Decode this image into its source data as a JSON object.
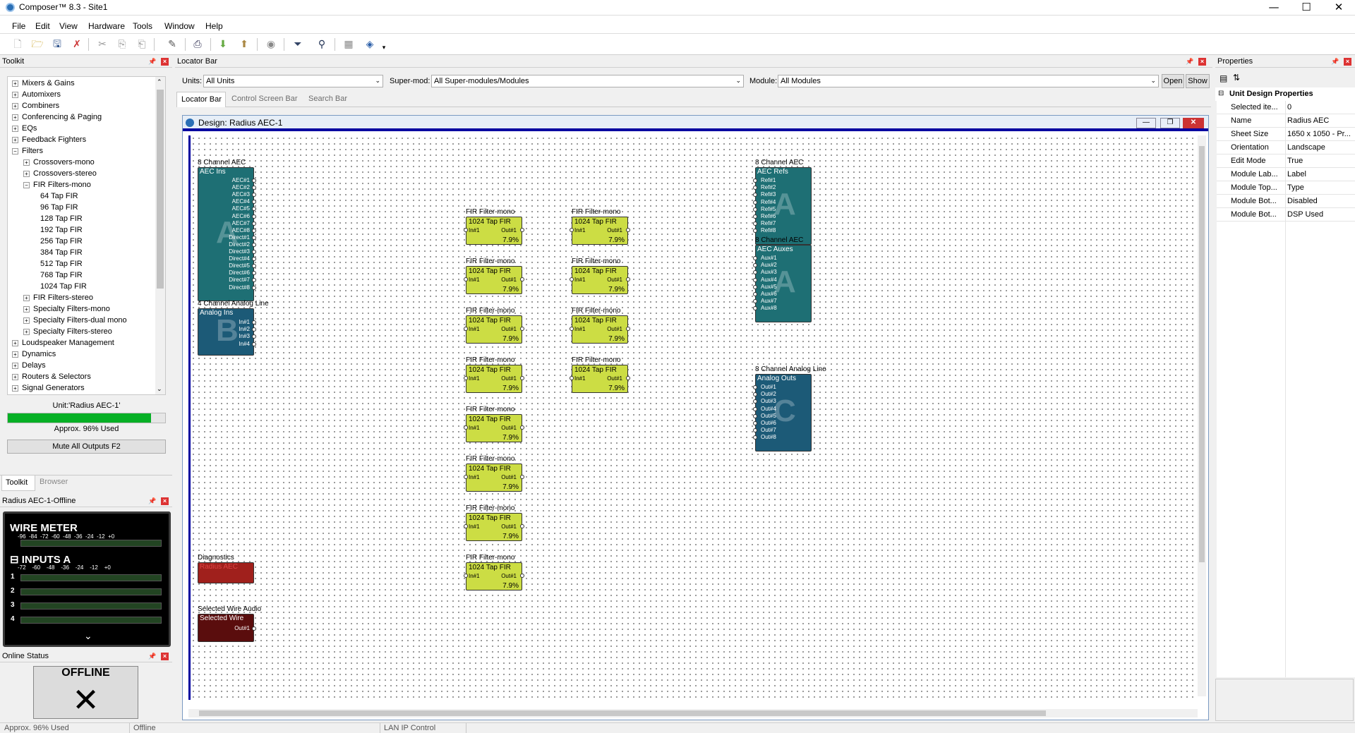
{
  "app": {
    "title": "Composer™ 8.3 - Site1"
  },
  "menu": [
    "File",
    "Edit",
    "View",
    "Hardware",
    "Tools",
    "Window",
    "Help"
  ],
  "toolkit": {
    "title": "Toolkit",
    "tree": [
      {
        "label": "Mixers & Gains",
        "expander": "+",
        "level": 0
      },
      {
        "label": "Automixers",
        "expander": "+",
        "level": 0
      },
      {
        "label": "Combiners",
        "expander": "+",
        "level": 0
      },
      {
        "label": "Conferencing & Paging",
        "expander": "+",
        "level": 0
      },
      {
        "label": "EQs",
        "expander": "+",
        "level": 0
      },
      {
        "label": "Feedback Fighters",
        "expander": "+",
        "level": 0
      },
      {
        "label": "Filters",
        "expander": "−",
        "level": 0
      },
      {
        "label": "Crossovers-mono",
        "expander": "+",
        "level": 1
      },
      {
        "label": "Crossovers-stereo",
        "expander": "+",
        "level": 1
      },
      {
        "label": "FIR Filters-mono",
        "expander": "−",
        "level": 1
      },
      {
        "label": "64 Tap FIR",
        "expander": "",
        "level": 2
      },
      {
        "label": "96 Tap FIR",
        "expander": "",
        "level": 2
      },
      {
        "label": "128 Tap FIR",
        "expander": "",
        "level": 2
      },
      {
        "label": "192 Tap FIR",
        "expander": "",
        "level": 2
      },
      {
        "label": "256 Tap FIR",
        "expander": "",
        "level": 2
      },
      {
        "label": "384 Tap FIR",
        "expander": "",
        "level": 2
      },
      {
        "label": "512 Tap FIR",
        "expander": "",
        "level": 2
      },
      {
        "label": "768 Tap FIR",
        "expander": "",
        "level": 2
      },
      {
        "label": "1024 Tap FIR",
        "expander": "",
        "level": 2
      },
      {
        "label": "FIR Filters-stereo",
        "expander": "+",
        "level": 1
      },
      {
        "label": "Specialty Filters-mono",
        "expander": "+",
        "level": 1
      },
      {
        "label": "Specialty Filters-dual mono",
        "expander": "+",
        "level": 1
      },
      {
        "label": "Specialty Filters-stereo",
        "expander": "+",
        "level": 1
      },
      {
        "label": "Loudspeaker Management",
        "expander": "+",
        "level": 0
      },
      {
        "label": "Dynamics",
        "expander": "+",
        "level": 0
      },
      {
        "label": "Delays",
        "expander": "+",
        "level": 0
      },
      {
        "label": "Routers & Selectors",
        "expander": "+",
        "level": 0
      },
      {
        "label": "Signal Generators",
        "expander": "+",
        "level": 0
      }
    ],
    "unit_label": "Unit:'Radius AEC-1'",
    "usage_label": "Approx. 96% Used",
    "usage_fraction": 0.96,
    "mute_button": "Mute All Outputs  F2",
    "tabs": [
      "Toolkit",
      "Browser"
    ]
  },
  "meter_panel": {
    "title": "Radius AEC-1-Offline",
    "wire_meter": "WIRE METER",
    "scale1": "-96  -84  -72  -60  -48  -36  -24  -12  +0",
    "inputs": "INPUTS A",
    "scale2": "-72    -60    -48    -36    -24    -12    +0",
    "rows": [
      "1",
      "2",
      "3",
      "4"
    ],
    "chevron": "⌄"
  },
  "online": {
    "title": "Online Status",
    "text": "OFFLINE"
  },
  "locator": {
    "title": "Locator Bar",
    "units_label": "Units:",
    "units_value": "All Units",
    "supermod_label": "Super-mod:",
    "supermod_value": "All Super-modules/Modules",
    "module_label": "Module:",
    "module_value": "All Modules",
    "open": "Open",
    "show": "Show",
    "tabs": [
      "Locator Bar",
      "Control Screen Bar",
      "Search Bar"
    ]
  },
  "design": {
    "title": "Design: Radius AEC-1",
    "aec_ins": {
      "caption": "8 Channel AEC",
      "title": "AEC Ins",
      "ports": [
        "AEC#1",
        "AEC#2",
        "AEC#3",
        "AEC#4",
        "AEC#5",
        "AEC#6",
        "AEC#7",
        "AEC#8",
        "Direct#1",
        "Direct#2",
        "Direct#3",
        "Direct#4",
        "Direct#5",
        "Direct#6",
        "Direct#7",
        "Direct#8"
      ],
      "letter": "A"
    },
    "analog_ins": {
      "caption": "4 Channel Analog Line",
      "title": "Analog Ins",
      "ports": [
        "In#1",
        "In#2",
        "In#3",
        "In#4"
      ],
      "letter": "B"
    },
    "aec_refs": {
      "caption": "8 Channel AEC",
      "title": "AEC Refs",
      "ports": [
        "Ref#1",
        "Ref#2",
        "Ref#3",
        "Ref#4",
        "Ref#5",
        "Ref#6",
        "Ref#7",
        "Ref#8"
      ],
      "letter": "A"
    },
    "aec_auxes": {
      "caption": "8 Channel AEC",
      "title": "AEC Auxes",
      "ports": [
        "Aux#1",
        "Aux#2",
        "Aux#3",
        "Aux#4",
        "Aux#5",
        "Aux#6",
        "Aux#7",
        "Aux#8"
      ],
      "letter": "A"
    },
    "analog_outs": {
      "caption": "8 Channel Analog Line",
      "title": "Analog Outs",
      "ports": [
        "Out#1",
        "Out#2",
        "Out#3",
        "Out#4",
        "Out#5",
        "Out#6",
        "Out#7",
        "Out#8"
      ],
      "letter": "C"
    },
    "diagnostics": {
      "caption": "Diagnostics",
      "title": "Radius AEC"
    },
    "selected_wire": {
      "caption": "Selected Wire Audio",
      "title": "Selected Wire",
      "port": "Out#1"
    },
    "fir": {
      "caption": "FIR Filter-mono",
      "title": "1024 Tap FIR",
      "in": "In#1",
      "out": "Out#1",
      "usage": "7.9%"
    }
  },
  "properties": {
    "title": "Properties",
    "section": "Unit Design Properties",
    "rows": [
      {
        "k": "Selected ite...",
        "v": "0"
      },
      {
        "k": "Name",
        "v": "Radius AEC"
      },
      {
        "k": "Sheet Size",
        "v": "1650 x 1050 - Pr..."
      },
      {
        "k": "Orientation",
        "v": "Landscape"
      },
      {
        "k": "Edit Mode",
        "v": "True"
      },
      {
        "k": "Module Lab...",
        "v": "Label"
      },
      {
        "k": "Module Top...",
        "v": "Type"
      },
      {
        "k": "Module Bot...",
        "v": "Disabled"
      },
      {
        "k": "Module Bot...",
        "v": "DSP Used"
      }
    ]
  },
  "status": {
    "left": "Approx. 96% Used",
    "mid": "Offline",
    "right": "LAN IP Control"
  },
  "colors": {
    "teal": "#1e6f74",
    "blue": "#1c5a77",
    "fir": "#ccdd44",
    "red": "#8b1d1d",
    "accent": "#0000a0"
  }
}
